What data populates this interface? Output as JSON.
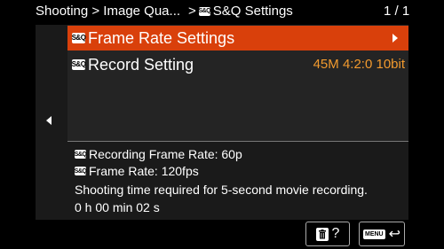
{
  "header": {
    "breadcrumb_1": "Shooting > Image Qua...",
    "breadcrumb_2": "> ",
    "sq_badge": "S&Q",
    "title": "S&Q Settings",
    "page": "1 / 1"
  },
  "menu": {
    "items": [
      {
        "badge": "S&Q",
        "label": "Frame Rate Settings",
        "value": ""
      },
      {
        "badge": "S&Q",
        "label": "Record Setting",
        "value": "45M 4:2:0 10bit"
      }
    ]
  },
  "info": {
    "badge": "S&Q",
    "recording_frame_rate": "Recording Frame Rate: 60p",
    "frame_rate": "Frame Rate: 120fps",
    "description": "Shooting time required for 5-second movie recording.",
    "time": "0 h 00 min 02 s"
  },
  "buttons": {
    "help": "?",
    "menu_chip": "MENU",
    "return_symbol": "↩"
  },
  "colors": {
    "accent": "#d9400b",
    "value": "#f29a2e",
    "background": "#000000",
    "panel": "#1a1a1a"
  },
  "icons": [
    "trash-icon",
    "help-icon",
    "menu-icon",
    "return-icon",
    "left-arrow-icon",
    "right-arrow-icon"
  ]
}
